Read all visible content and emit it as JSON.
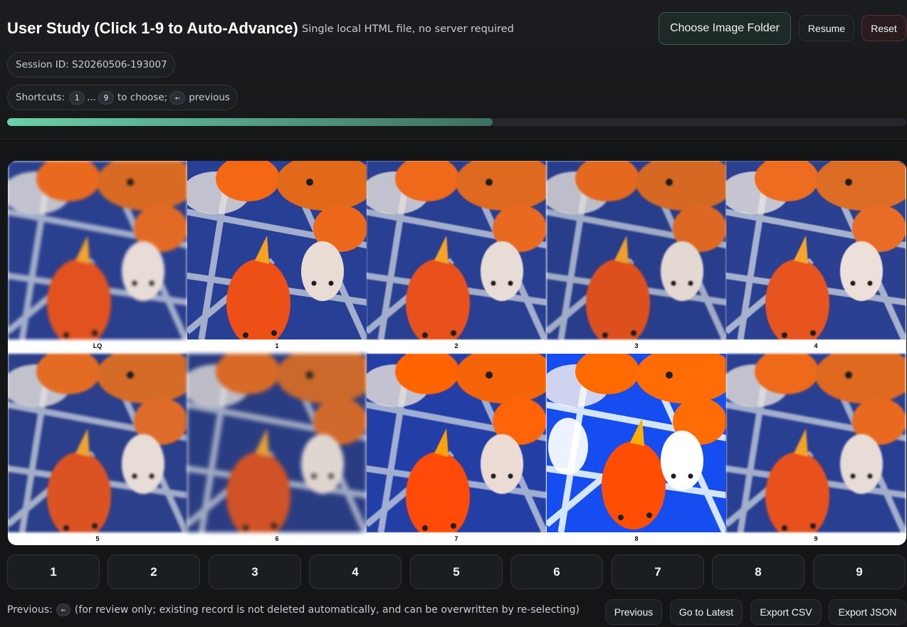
{
  "header": {
    "title": "User Study (Click 1-9 to Auto-Advance)",
    "subtitle": "Single local HTML file, no server required",
    "choose_folder_label": "Choose Image Folder",
    "resume_label": "Resume",
    "reset_label": "Reset",
    "session_label": "Session ID: S20260506-193007",
    "shortcuts": {
      "prefix": "Shortcuts:",
      "key_first": "1",
      "ellipsis": "...",
      "key_last": "9",
      "middle": "to choose;",
      "key_prev": "←",
      "suffix": "previous"
    },
    "progress_fraction": 0.54
  },
  "grid": {
    "captions": [
      "LQ",
      "1",
      "2",
      "3",
      "4",
      "5",
      "6",
      "7",
      "8",
      "9"
    ]
  },
  "choices": [
    "1",
    "2",
    "3",
    "4",
    "5",
    "6",
    "7",
    "8",
    "9"
  ],
  "footer": {
    "previous_prefix": "Previous:",
    "previous_key": "←",
    "note": "(for review only; existing record is not deleted automatically, and can be overwritten by re-selecting)",
    "previous_label": "Previous",
    "latest_label": "Go to Latest",
    "export_csv_label": "Export CSV",
    "export_json_label": "Export JSON"
  },
  "colors": {
    "accent": "#69d0a9",
    "background": "#131517",
    "danger_border": "#5a2e34"
  }
}
